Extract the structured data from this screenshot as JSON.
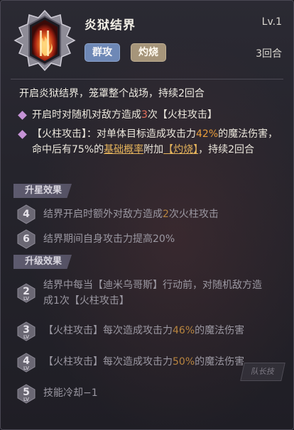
{
  "skill": {
    "name": "炎狱结界",
    "level": "Lv.1",
    "tags": [
      "群攻",
      "灼烧"
    ],
    "duration": "3回合",
    "description": "开启炎狱结界，笼罩整个战场，持续2回合"
  },
  "effects": [
    {
      "parts": [
        "开启时对随机对敌方造成",
        "3",
        "次【火柱攻击】"
      ]
    },
    {
      "parts": [
        "【火柱攻击】：对单体目标造成攻击力",
        "42%",
        "的魔法伤害，命中后有75%的",
        "基础概率",
        "附加",
        "【灼烧】",
        "，持续2回合"
      ]
    }
  ],
  "star_section": {
    "title": "升星效果",
    "items": [
      {
        "star": "4",
        "parts": [
          "结界开启时额外对敌方造成",
          "2",
          "次火柱攻击"
        ]
      },
      {
        "star": "6",
        "parts": [
          "结界期间自身攻击力提高20%"
        ]
      }
    ]
  },
  "upgrade_section": {
    "title": "升级效果",
    "lv_label": "LV",
    "items": [
      {
        "level": "2",
        "parts": [
          "结界中每当【迪米乌哥斯】行动前，对随机敌方造成1次【火柱攻击】"
        ]
      },
      {
        "level": "3",
        "parts": [
          "【火柱攻击】每次造成攻击力",
          "46%",
          "的魔法伤害"
        ]
      },
      {
        "level": "4",
        "parts": [
          "【火柱攻击】每次造成攻击力",
          "50%",
          "的魔法伤害"
        ]
      },
      {
        "level": "5",
        "parts": [
          "技能冷却−1"
        ]
      }
    ]
  },
  "badge": "队长技",
  "colors": {
    "highlight_red": "#e7715d",
    "highlight_orange": "#e99d3b",
    "tag_aoe": "#6e88b6",
    "tag_burn": "#a6957a"
  }
}
